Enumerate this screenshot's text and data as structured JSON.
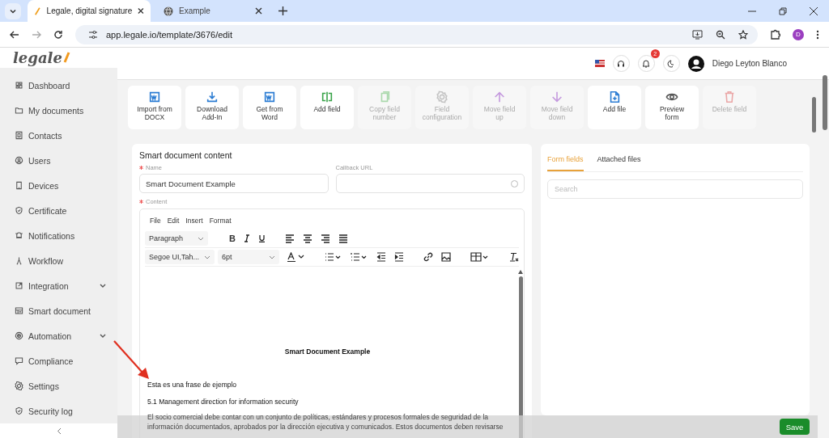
{
  "browser": {
    "tabs": [
      {
        "title": "Legale, digital signature",
        "selected": true
      },
      {
        "title": "Example",
        "selected": false
      }
    ],
    "url": "app.legale.io/template/3676/edit",
    "profile_initial": "D"
  },
  "header": {
    "logo": "legale",
    "notification_count": "2",
    "user_name": "Diego Leyton Blanco"
  },
  "sidebar": {
    "items": [
      {
        "label": "Dashboard",
        "expandable": false
      },
      {
        "label": "My documents",
        "expandable": false
      },
      {
        "label": "Contacts",
        "expandable": false
      },
      {
        "label": "Users",
        "expandable": false
      },
      {
        "label": "Devices",
        "expandable": false
      },
      {
        "label": "Certificate",
        "expandable": false
      },
      {
        "label": "Notifications",
        "expandable": false
      },
      {
        "label": "Workflow",
        "expandable": false
      },
      {
        "label": "Integration",
        "expandable": true
      },
      {
        "label": "Smart document",
        "expandable": false
      },
      {
        "label": "Automation",
        "expandable": true
      },
      {
        "label": "Compliance",
        "expandable": false
      },
      {
        "label": "Settings",
        "expandable": false
      },
      {
        "label": "Security log",
        "expandable": false
      }
    ]
  },
  "toolbar": [
    {
      "label": [
        "Import from",
        "DOCX"
      ],
      "disabled": false
    },
    {
      "label": [
        "Download",
        "Add-In"
      ],
      "disabled": false
    },
    {
      "label": [
        "Get from",
        "Word"
      ],
      "disabled": false
    },
    {
      "label": [
        "Add field"
      ],
      "disabled": false
    },
    {
      "label": [
        "Copy field",
        "number"
      ],
      "disabled": true
    },
    {
      "label": [
        "Field",
        "configuration"
      ],
      "disabled": true
    },
    {
      "label": [
        "Move field",
        "up"
      ],
      "disabled": true
    },
    {
      "label": [
        "Move field",
        "down"
      ],
      "disabled": true
    },
    {
      "label": [
        "Add file"
      ],
      "disabled": false
    },
    {
      "label": [
        "Preview",
        "form"
      ],
      "disabled": false
    },
    {
      "label": [
        "Delete field"
      ],
      "disabled": true
    }
  ],
  "content_card": {
    "title": "Smart document content",
    "name_label": "Name",
    "name_required": true,
    "name_value": "Smart Document Example",
    "callback_label": "Callback URL",
    "callback_required": false,
    "content_label": "Content",
    "content_required": true,
    "editor": {
      "menus": [
        "File",
        "Edit",
        "Insert",
        "Format"
      ],
      "block_format": "Paragraph",
      "bold_button": "B",
      "font_family": "Segoe UI,Tah...",
      "font_size": "6pt",
      "document": {
        "title": "Smart Document Example",
        "lines": [
          "Esta es una frase de ejemplo",
          "5.1 Management direction for information security"
        ],
        "paragraph_lines": [
          "El socio comercial debe contar con un conjunto de políticas, estándares y procesos formales de seguridad de la",
          "información documentados, aprobados por la dirección ejecutiva y comunicados. Estos documentos deben revisarse"
        ]
      }
    }
  },
  "side_card": {
    "tabs": [
      {
        "label": "Form fields",
        "selected": true
      },
      {
        "label": "Attached files",
        "selected": false
      }
    ],
    "search_placeholder": "Search"
  },
  "footer": {
    "save": "Save"
  }
}
